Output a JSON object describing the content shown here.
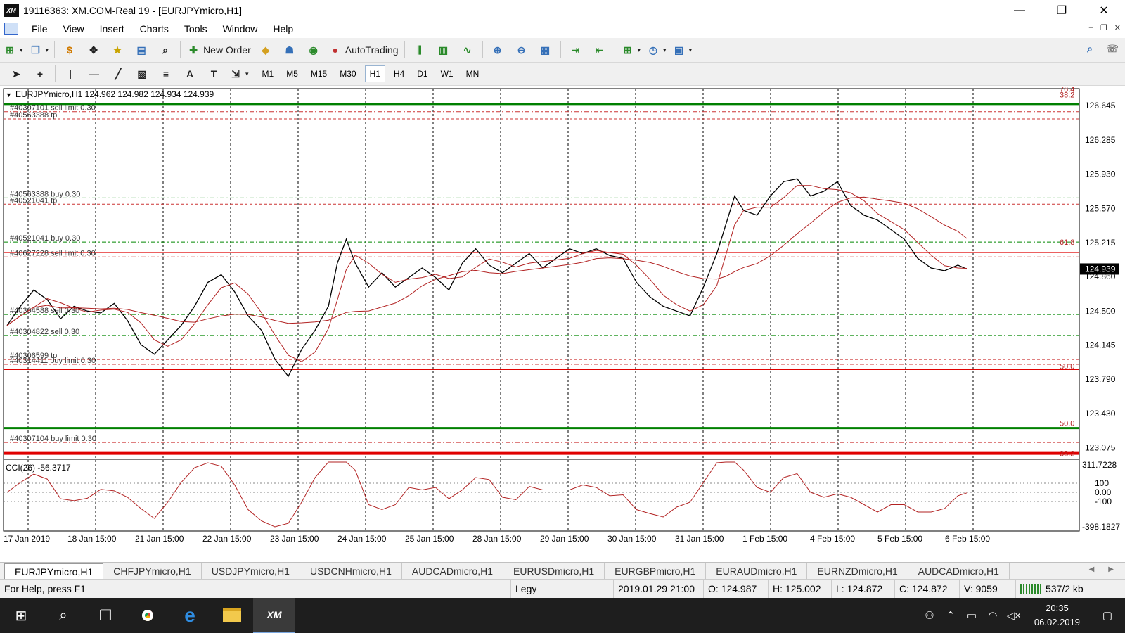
{
  "window": {
    "title": "19116363: XM.COM-Real 19 - [EURJPYmicro,H1]",
    "logo_text": "XM",
    "minimize": "—",
    "maximize": "❐",
    "close": "✕"
  },
  "menu": [
    "File",
    "View",
    "Insert",
    "Charts",
    "Tools",
    "Window",
    "Help"
  ],
  "toolbar": {
    "new_order": "New Order",
    "autotrading": "AutoTrading"
  },
  "timeframes": [
    "M1",
    "M5",
    "M15",
    "M30",
    "H1",
    "H4",
    "D1",
    "W1",
    "MN"
  ],
  "active_timeframe": "H1",
  "chart": {
    "header": "EURJPYmicro,H1  124.962 124.982 124.934 124.939",
    "current_price": "124.939",
    "price_axis": [
      {
        "label": "126.645",
        "price": 126.645
      },
      {
        "label": "126.285",
        "price": 126.285
      },
      {
        "label": "125.930",
        "price": 125.93
      },
      {
        "label": "125.570",
        "price": 125.57
      },
      {
        "label": "125.215",
        "price": 125.215
      },
      {
        "label": "124.860",
        "price": 124.86
      },
      {
        "label": "124.500",
        "price": 124.5
      },
      {
        "label": "124.145",
        "price": 124.145
      },
      {
        "label": "123.790",
        "price": 123.79
      },
      {
        "label": "123.430",
        "price": 123.43
      },
      {
        "label": "123.075",
        "price": 123.075
      }
    ],
    "order_lines": [
      {
        "label": "#40307101 sell limit 0.30",
        "price": 126.58,
        "color": "#cc3333",
        "dash": "6 3 2 3"
      },
      {
        "label": "#40563388 tp",
        "price": 126.505,
        "color": "#cc3333",
        "dash": "4 3"
      },
      {
        "label": "#40563388 buy 0.30",
        "price": 125.68,
        "color": "#008800",
        "dash": "6 3 2 3"
      },
      {
        "label": "#40521041 tp",
        "price": 125.615,
        "color": "#cc3333",
        "dash": "4 3"
      },
      {
        "label": "#40521041 buy 0.30",
        "price": 125.22,
        "color": "#008800",
        "dash": "6 3 2 3"
      },
      {
        "label": "#40627228 sell limit 0.30",
        "price": 125.065,
        "color": "#cc3333",
        "dash": "6 3 2 3"
      },
      {
        "label": "#40304588 sell 0.30",
        "price": 124.465,
        "color": "#008800",
        "dash": "6 3 2 3"
      },
      {
        "label": "#40304822 sell 0.30",
        "price": 124.245,
        "color": "#008800",
        "dash": "6 3 2 3"
      },
      {
        "label": "#40306599 tp",
        "price": 123.995,
        "color": "#cc3333",
        "dash": "4 3"
      },
      {
        "label": "#40314411 buy limit 0.30",
        "price": 123.945,
        "color": "#cc3333",
        "dash": "6 3 2 3"
      },
      {
        "label": "#40307104 buy limit 0.30",
        "price": 123.13,
        "color": "#cc3333",
        "dash": "6 3 2 3"
      }
    ],
    "fibo_levels": [
      {
        "label": "76.4",
        "price": 126.78
      },
      {
        "label": "38.2",
        "price": 126.72
      },
      {
        "label": "61.8",
        "price": 125.185
      },
      {
        "label": "50.0",
        "price": 123.89
      },
      {
        "label": "50.0",
        "price": 123.295
      },
      {
        "label": "38.2",
        "price": 122.98
      }
    ],
    "green_levels": [
      126.66,
      123.28
    ],
    "red_levels": [
      123.02,
      123.89,
      125.11
    ],
    "date_labels": [
      "17 Jan 2019",
      "18 Jan 15:00",
      "21 Jan 15:00",
      "22 Jan 15:00",
      "23 Jan 15:00",
      "24 Jan 15:00",
      "25 Jan 15:00",
      "28 Jan 15:00",
      "29 Jan 15:00",
      "30 Jan 15:00",
      "31 Jan 15:00",
      "1 Feb 15:00",
      "4 Feb 15:00",
      "5 Feb 15:00",
      "6 Feb 15:00"
    ],
    "price_path": [
      [
        0,
        124.35
      ],
      [
        3,
        124.55
      ],
      [
        6,
        124.72
      ],
      [
        9,
        124.62
      ],
      [
        12,
        124.42
      ],
      [
        15,
        124.55
      ],
      [
        18,
        124.5
      ],
      [
        21,
        124.48
      ],
      [
        24,
        124.58
      ],
      [
        27,
        124.4
      ],
      [
        30,
        124.15
      ],
      [
        33,
        124.05
      ],
      [
        36,
        124.2
      ],
      [
        39,
        124.35
      ],
      [
        42,
        124.55
      ],
      [
        45,
        124.8
      ],
      [
        48,
        124.88
      ],
      [
        51,
        124.7
      ],
      [
        54,
        124.45
      ],
      [
        57,
        124.3
      ],
      [
        60,
        124.0
      ],
      [
        63,
        123.82
      ],
      [
        66,
        124.1
      ],
      [
        69,
        124.3
      ],
      [
        72,
        124.55
      ],
      [
        74,
        125.0
      ],
      [
        76,
        125.25
      ],
      [
        78,
        125.0
      ],
      [
        81,
        124.75
      ],
      [
        84,
        124.9
      ],
      [
        87,
        124.75
      ],
      [
        90,
        124.85
      ],
      [
        93,
        124.95
      ],
      [
        96,
        124.85
      ],
      [
        99,
        124.72
      ],
      [
        102,
        125.0
      ],
      [
        105,
        125.15
      ],
      [
        108,
        124.98
      ],
      [
        111,
        124.9
      ],
      [
        114,
        125.0
      ],
      [
        117,
        125.1
      ],
      [
        120,
        124.95
      ],
      [
        123,
        125.05
      ],
      [
        126,
        125.15
      ],
      [
        129,
        125.1
      ],
      [
        132,
        125.15
      ],
      [
        135,
        125.08
      ],
      [
        138,
        125.05
      ],
      [
        141,
        124.8
      ],
      [
        144,
        124.65
      ],
      [
        147,
        124.55
      ],
      [
        150,
        124.5
      ],
      [
        153,
        124.45
      ],
      [
        156,
        124.75
      ],
      [
        159,
        125.1
      ],
      [
        161,
        125.4
      ],
      [
        163,
        125.7
      ],
      [
        165,
        125.55
      ],
      [
        168,
        125.5
      ],
      [
        171,
        125.7
      ],
      [
        174,
        125.85
      ],
      [
        177,
        125.88
      ],
      [
        180,
        125.7
      ],
      [
        183,
        125.75
      ],
      [
        186,
        125.85
      ],
      [
        189,
        125.6
      ],
      [
        192,
        125.5
      ],
      [
        195,
        125.45
      ],
      [
        198,
        125.35
      ],
      [
        201,
        125.25
      ],
      [
        204,
        125.05
      ],
      [
        207,
        124.95
      ],
      [
        210,
        124.92
      ],
      [
        213,
        124.98
      ],
      [
        215,
        124.939
      ]
    ],
    "cci": {
      "label": "CCI(26) -56.3717",
      "max_label": "311.7228",
      "min_label": "-398.1827",
      "level_labels": [
        "100",
        "0.00",
        "-100"
      ]
    }
  },
  "symbol_tabs": [
    "EURJPYmicro,H1",
    "CHFJPYmicro,H1",
    "USDJPYmicro,H1",
    "USDCNHmicro,H1",
    "AUDCADmicro,H1",
    "EURUSDmicro,H1",
    "EURGBPmicro,H1",
    "EURAUDmicro,H1",
    "EURNZDmicro,H1",
    "AUDCADmicro,H1"
  ],
  "status": {
    "help": "For Help, press F1",
    "profile": "Legy",
    "datetime": "2019.01.29 21:00",
    "open": "O: 124.987",
    "high": "H: 125.002",
    "low": "L: 124.872",
    "close": "C: 124.872",
    "volume": "V: 9059",
    "traffic": "537/2 kb"
  },
  "taskbar": {
    "xm_label": "XM",
    "time": "20:35",
    "date": "06.02.2019"
  },
  "colors": {
    "price_line": "#000000",
    "ma_line": "#b22222",
    "cci_line": "#b22222",
    "green": "#008000",
    "red": "#e00000"
  }
}
